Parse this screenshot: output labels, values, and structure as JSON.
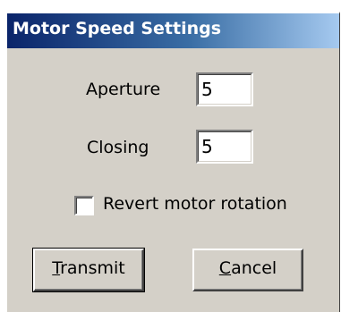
{
  "window": {
    "title": "Motor Speed Settings"
  },
  "fields": {
    "aperture": {
      "label": "Aperture",
      "value": "5"
    },
    "closing": {
      "label": "Closing",
      "value": "5"
    }
  },
  "options": {
    "revert_motor_rotation": {
      "label": "Revert motor rotation",
      "checked": false
    }
  },
  "buttons": {
    "transmit": {
      "mnemonic": "T",
      "rest": "ransmit"
    },
    "cancel": {
      "mnemonic": "C",
      "rest": "ancel"
    }
  },
  "colors": {
    "titlebar_start": "#0a246a",
    "titlebar_end": "#a6caf0",
    "dialog_face": "#d4d0c8"
  }
}
